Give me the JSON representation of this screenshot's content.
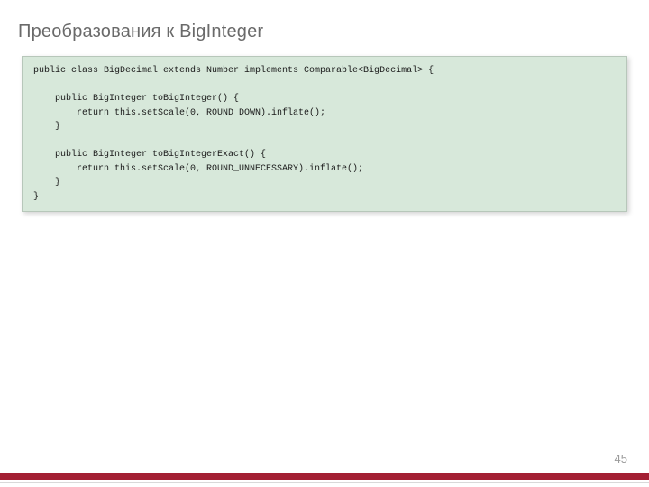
{
  "title": "Преобразования к BigInteger",
  "code": "public class BigDecimal extends Number implements Comparable<BigDecimal> {\n\n    public BigInteger toBigInteger() {\n        return this.setScale(0, ROUND_DOWN).inflate();\n    }\n\n    public BigInteger toBigIntegerExact() {\n        return this.setScale(0, ROUND_UNNECESSARY).inflate();\n    }\n}",
  "page_number": "45"
}
